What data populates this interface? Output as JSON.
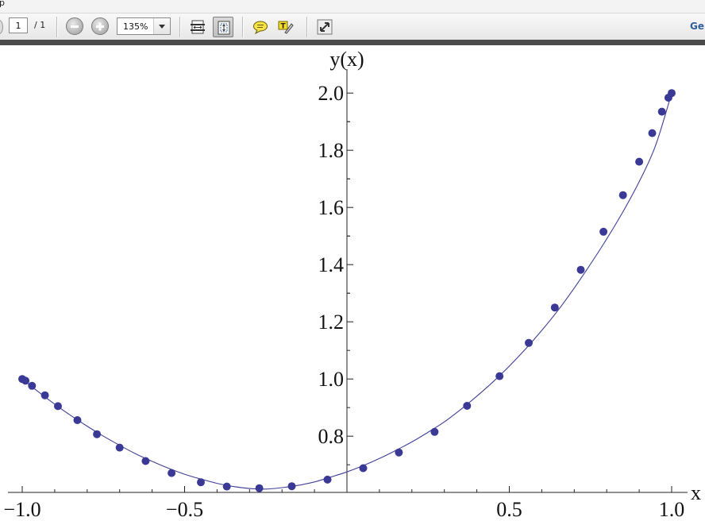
{
  "window": {
    "title_fragment": "p"
  },
  "toolbar": {
    "page_current": "1",
    "page_total": "/ 1",
    "zoom_value": "135%",
    "get_label": "Ge",
    "icons": [
      "zoom-out-icon",
      "zoom-in-icon",
      "fit-width-icon",
      "fit-page-icon",
      "comment-icon",
      "highlight-text-icon",
      "full-screen-icon"
    ]
  },
  "chart_data": {
    "type": "line",
    "title": "",
    "xlabel": "x",
    "ylabel": "y(x)",
    "xlim": [
      -1.0,
      1.0
    ],
    "ylim": [
      0.62,
      2.02
    ],
    "x_ticks": [
      {
        "value": -1.0,
        "label": "−1.0"
      },
      {
        "value": -0.5,
        "label": "−0.5"
      },
      {
        "value": 0.5,
        "label": "0.5"
      },
      {
        "value": 1.0,
        "label": "1.0"
      }
    ],
    "y_ticks": [
      {
        "value": 0.8,
        "label": "0.8"
      },
      {
        "value": 1.0,
        "label": "1.0"
      },
      {
        "value": 1.2,
        "label": "1.2"
      },
      {
        "value": 1.4,
        "label": "1.4"
      },
      {
        "value": 1.6,
        "label": "1.6"
      },
      {
        "value": 1.8,
        "label": "1.8"
      },
      {
        "value": 2.0,
        "label": "2.0"
      }
    ],
    "series": [
      {
        "kind": "curve",
        "color": "#3f3f9a",
        "x": [
          -1.0,
          -0.95,
          -0.9,
          -0.85,
          -0.8,
          -0.75,
          -0.7,
          -0.65,
          -0.6,
          -0.55,
          -0.5,
          -0.45,
          -0.4,
          -0.35,
          -0.3,
          -0.25,
          -0.2,
          -0.15,
          -0.1,
          -0.05,
          0.0,
          0.05,
          0.1,
          0.15,
          0.2,
          0.25,
          0.3,
          0.35,
          0.4,
          0.45,
          0.5,
          0.55,
          0.6,
          0.65,
          0.7,
          0.75,
          0.8,
          0.85,
          0.9,
          0.95,
          1.0
        ],
        "y": [
          1.0,
          0.955,
          0.912,
          0.872,
          0.835,
          0.8,
          0.768,
          0.738,
          0.712,
          0.688,
          0.667,
          0.65,
          0.635,
          0.624,
          0.617,
          0.615,
          0.62,
          0.628,
          0.64,
          0.657,
          0.675,
          0.697,
          0.722,
          0.75,
          0.78,
          0.814,
          0.85,
          0.893,
          0.94,
          0.99,
          1.045,
          1.105,
          1.17,
          1.24,
          1.318,
          1.402,
          1.49,
          1.585,
          1.69,
          1.815,
          2.0
        ]
      },
      {
        "kind": "points",
        "color": "#3a3a96",
        "x": [
          -1.0,
          -0.99,
          -0.97,
          -0.93,
          -0.89,
          -0.83,
          -0.77,
          -0.7,
          -0.62,
          -0.54,
          -0.45,
          -0.37,
          -0.27,
          -0.17,
          -0.06,
          0.05,
          0.16,
          0.27,
          0.37,
          0.47,
          0.56,
          0.64,
          0.72,
          0.79,
          0.85,
          0.9,
          0.94,
          0.97,
          0.99,
          1.0
        ],
        "y": [
          1.0,
          0.994,
          0.976,
          0.943,
          0.905,
          0.856,
          0.807,
          0.76,
          0.713,
          0.671,
          0.639,
          0.624,
          0.618,
          0.625,
          0.648,
          0.688,
          0.743,
          0.815,
          0.906,
          1.01,
          1.126,
          1.25,
          1.382,
          1.515,
          1.643,
          1.76,
          1.86,
          1.935,
          1.984,
          2.0
        ]
      }
    ]
  }
}
